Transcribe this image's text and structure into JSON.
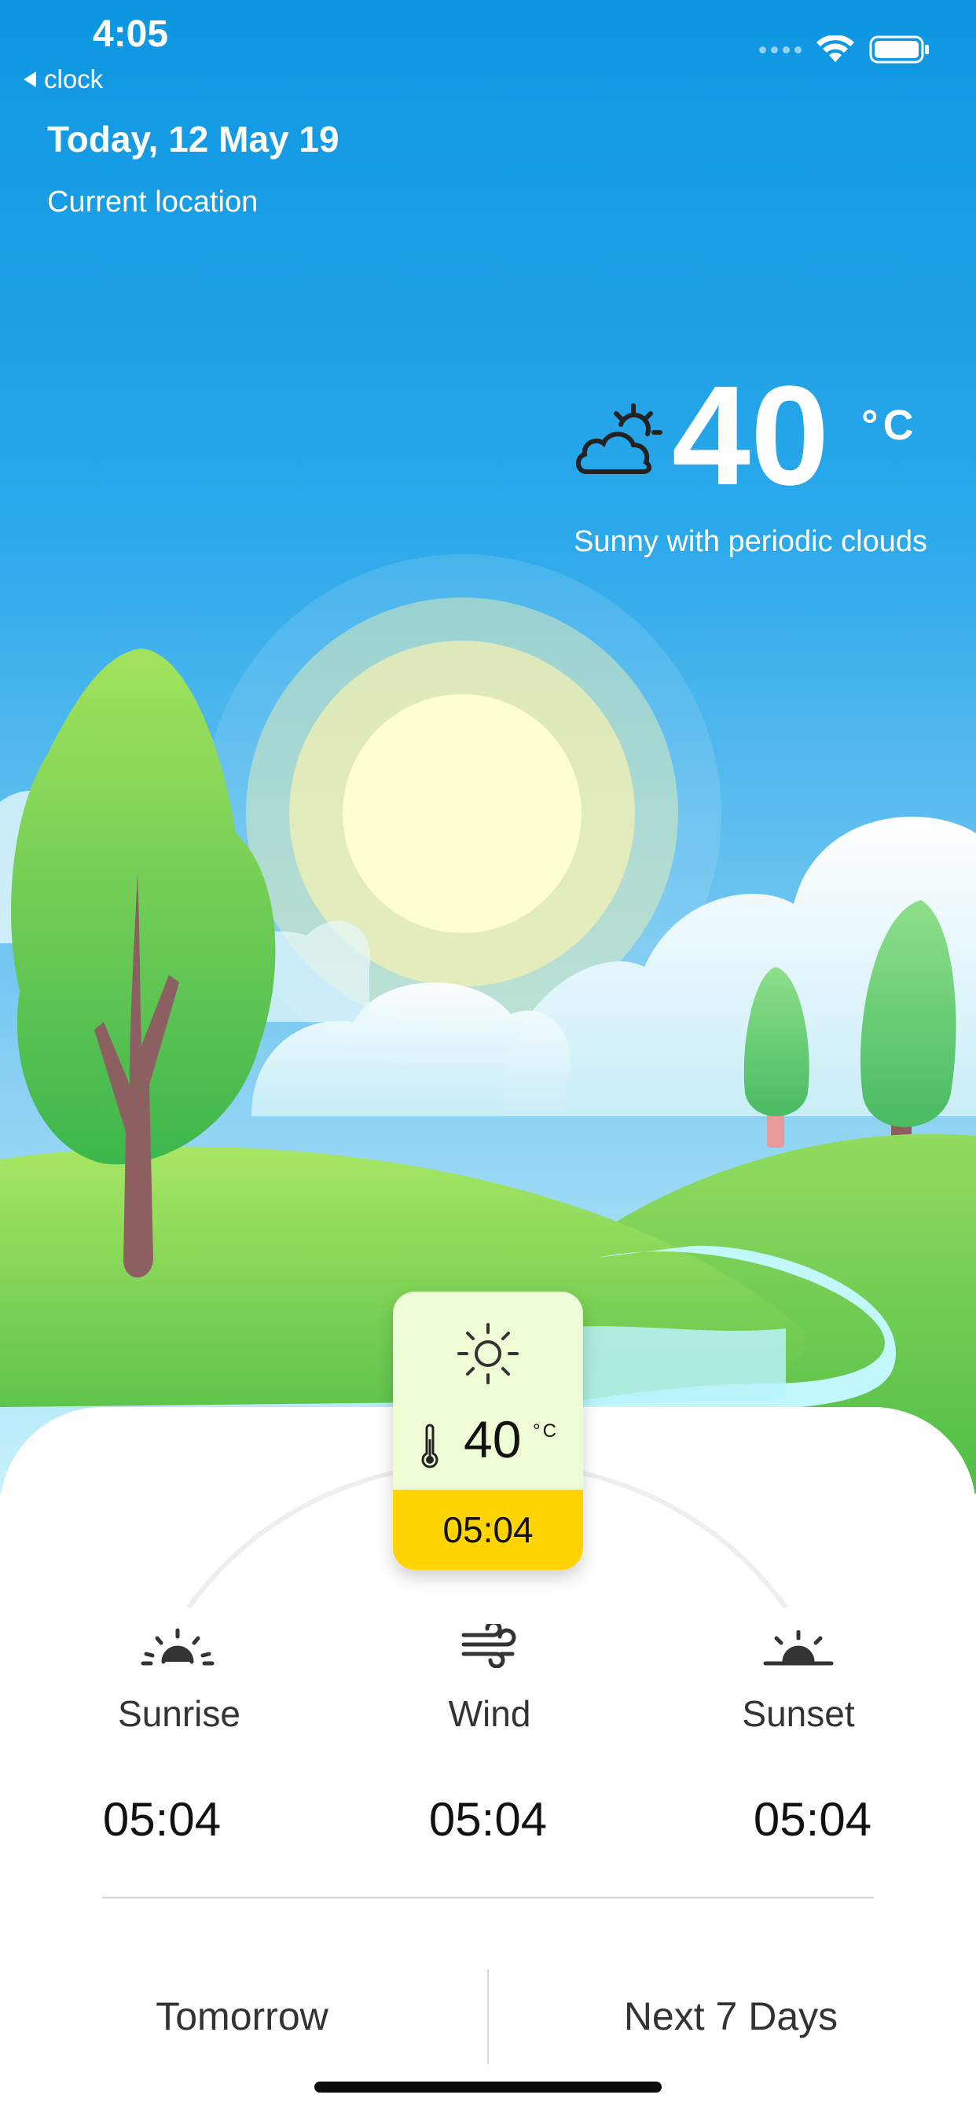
{
  "status_bar": {
    "time": "4:05",
    "back_label": "clock"
  },
  "header": {
    "date": "Today, 12 May 19",
    "location": "Current location"
  },
  "current": {
    "temperature": "40",
    "unit": "°C",
    "condition": "Sunny with periodic clouds",
    "icon": "partly-cloudy-icon"
  },
  "card": {
    "temperature": "40",
    "unit": "°C",
    "time": "05:04",
    "icon": "sun-icon"
  },
  "stats": [
    {
      "label": "Sunrise",
      "value": "05:04",
      "icon": "sunrise-icon"
    },
    {
      "label": "Wind",
      "value": "05:04",
      "icon": "wind-icon"
    },
    {
      "label": "Sunset",
      "value": "05:04",
      "icon": "sunset-icon"
    }
  ],
  "tabs": [
    {
      "label": "Tomorrow"
    },
    {
      "label": "Next 7 Days"
    }
  ],
  "colors": {
    "sky_top": "#0e98e0",
    "sky_bottom": "#b7ecf8",
    "grass": "#7fd654",
    "accent": "#ffd400"
  }
}
